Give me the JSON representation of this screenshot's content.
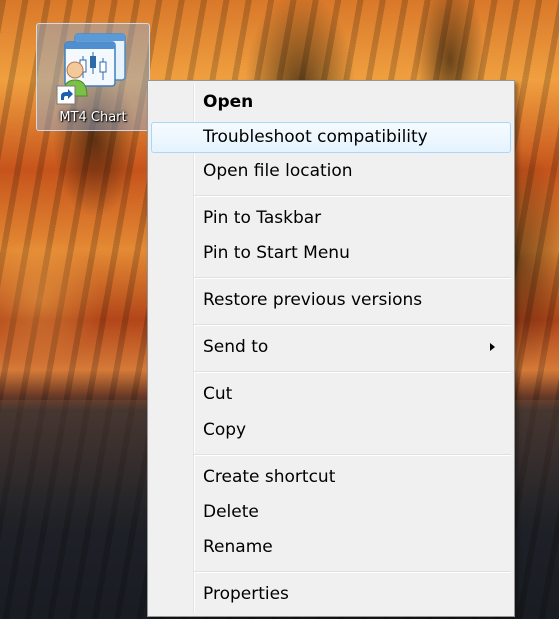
{
  "desktop": {
    "icon": {
      "label": "MT4 Chart",
      "icon_name": "mt4-chart-app-icon",
      "overlay": "shortcut-arrow-icon"
    }
  },
  "context_menu": {
    "items": [
      {
        "label": "Open",
        "bold": true
      },
      {
        "label": "Troubleshoot compatibility",
        "highlighted": true
      },
      {
        "label": "Open file location"
      },
      {
        "label": "Pin to Taskbar"
      },
      {
        "label": "Pin to Start Menu"
      },
      {
        "label": "Restore previous versions"
      },
      {
        "label": "Send to",
        "submenu": true,
        "submenu_icon": "chevron-right-icon"
      },
      {
        "label": "Cut"
      },
      {
        "label": "Copy"
      },
      {
        "label": "Create shortcut"
      },
      {
        "label": "Delete"
      },
      {
        "label": "Rename"
      },
      {
        "label": "Properties"
      }
    ]
  },
  "colors": {
    "highlight_border": "#a8d8f8",
    "menu_background": "#f0f0f0"
  }
}
